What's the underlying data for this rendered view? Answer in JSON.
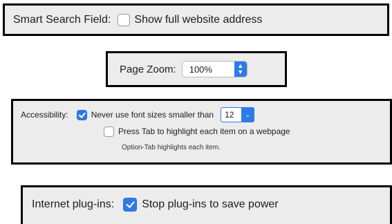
{
  "smart_search": {
    "label": "Smart Search Field:",
    "checkbox_label": "Show full website address",
    "checked": false
  },
  "page_zoom": {
    "label": "Page Zoom:",
    "value": "100%",
    "stepper_up": "▲",
    "stepper_down": "▼"
  },
  "accessibility": {
    "label": "Accessibility:",
    "min_font": {
      "label": "Never use font sizes smaller than",
      "checked": true,
      "value": "12",
      "arrow": "⌄"
    },
    "press_tab": {
      "label": "Press Tab to highlight each item on a webpage",
      "checked": false
    },
    "hint": "Option-Tab highlights each item."
  },
  "plugins": {
    "label": "Internet plug-ins:",
    "checkbox_label": "Stop plug-ins to save power",
    "checked": true
  },
  "colors": {
    "accent": "#2f7be5",
    "panel_bg": "#ececec",
    "panel_border": "#000000"
  }
}
